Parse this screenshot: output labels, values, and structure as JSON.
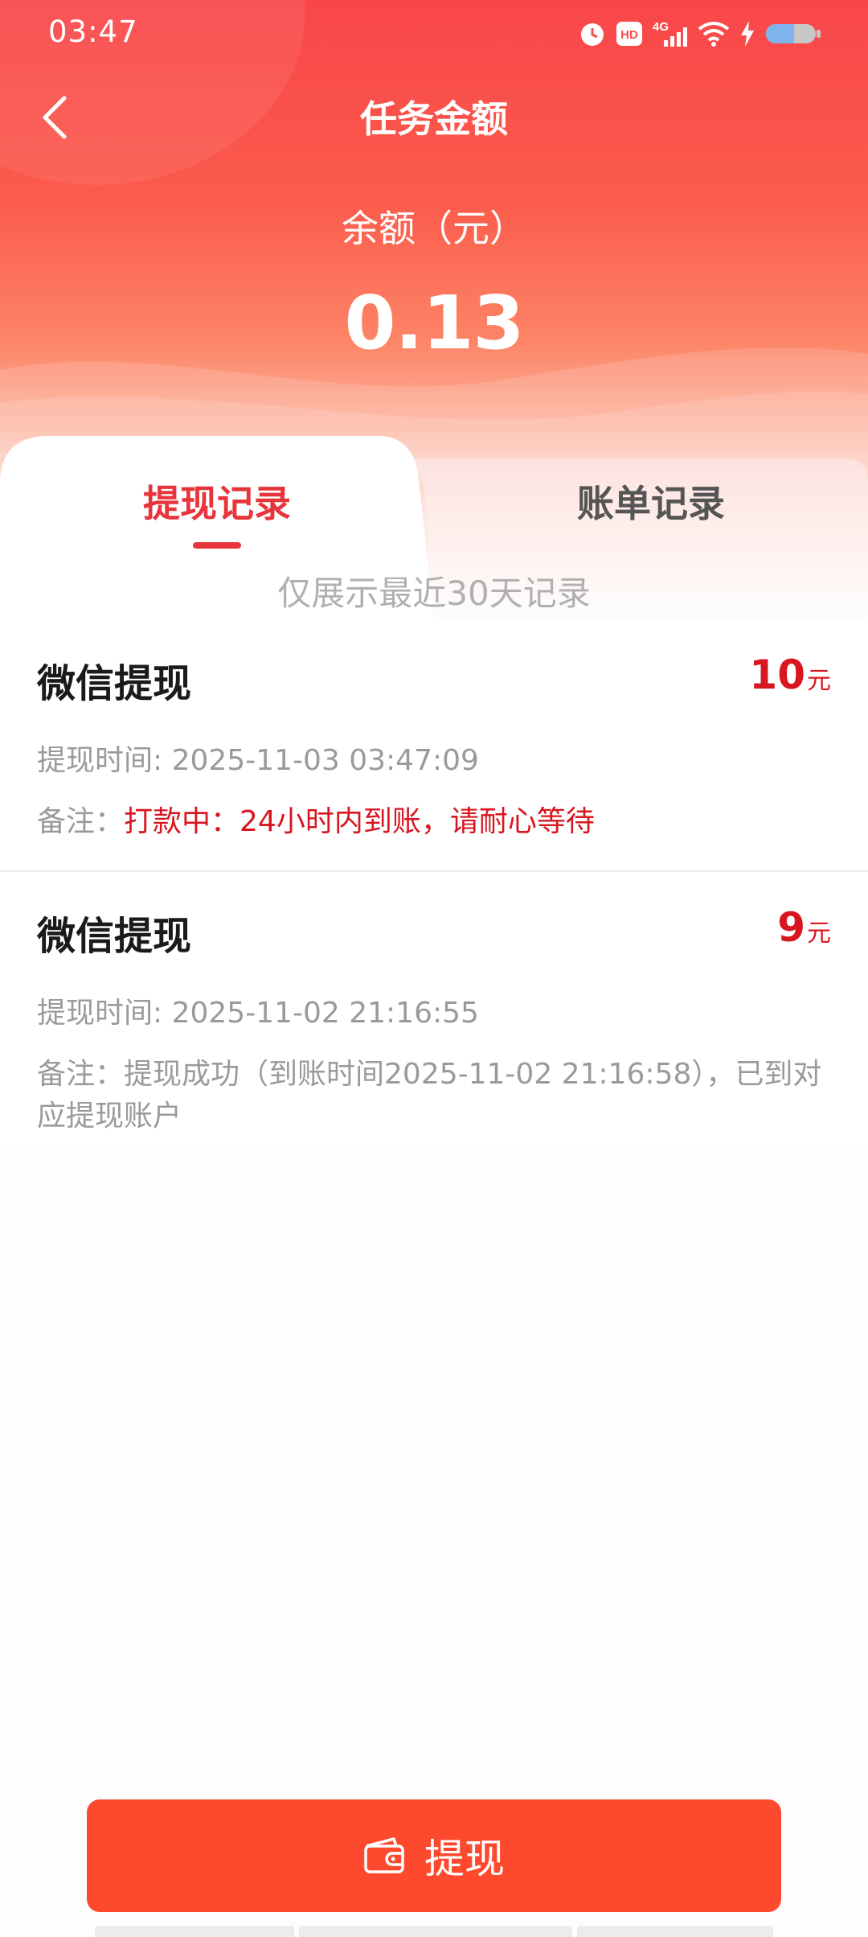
{
  "status_bar": {
    "time": "03:47",
    "icons": [
      "alarm-icon",
      "hd-icon",
      "4g-signal-icon",
      "wifi-icon",
      "charging-icon",
      "battery-icon"
    ],
    "hd_text": "HD",
    "network_text": "4G"
  },
  "header": {
    "title": "任务金额",
    "balance_label": "余额（元）",
    "balance_value": "0.13"
  },
  "tabs": [
    {
      "label": "提现记录",
      "active": true
    },
    {
      "label": "账单记录",
      "active": false
    }
  ],
  "notice": "仅展示最近30天记录",
  "records": [
    {
      "title": "微信提现",
      "amount": "10",
      "unit": "元",
      "time": "提现时间: 2025-11-03 03:47:09",
      "note_prefix": "备注：",
      "note": "打款中：24小时内到账，请耐心等待",
      "note_color": "#d8161f"
    },
    {
      "title": "微信提现",
      "amount": "9",
      "unit": "元",
      "time": "提现时间: 2025-11-02 21:16:55",
      "note_prefix": "备注：",
      "note": "提现成功（到账时间2025-11-02 21:16:58），已到对应提现账户",
      "note_color": "#9a9a9a"
    }
  ],
  "action": {
    "label": "提现",
    "icon": "wallet-icon"
  },
  "colors": {
    "accent": "#e8343b",
    "button": "#fd4a2e",
    "amount": "#d8161f"
  }
}
